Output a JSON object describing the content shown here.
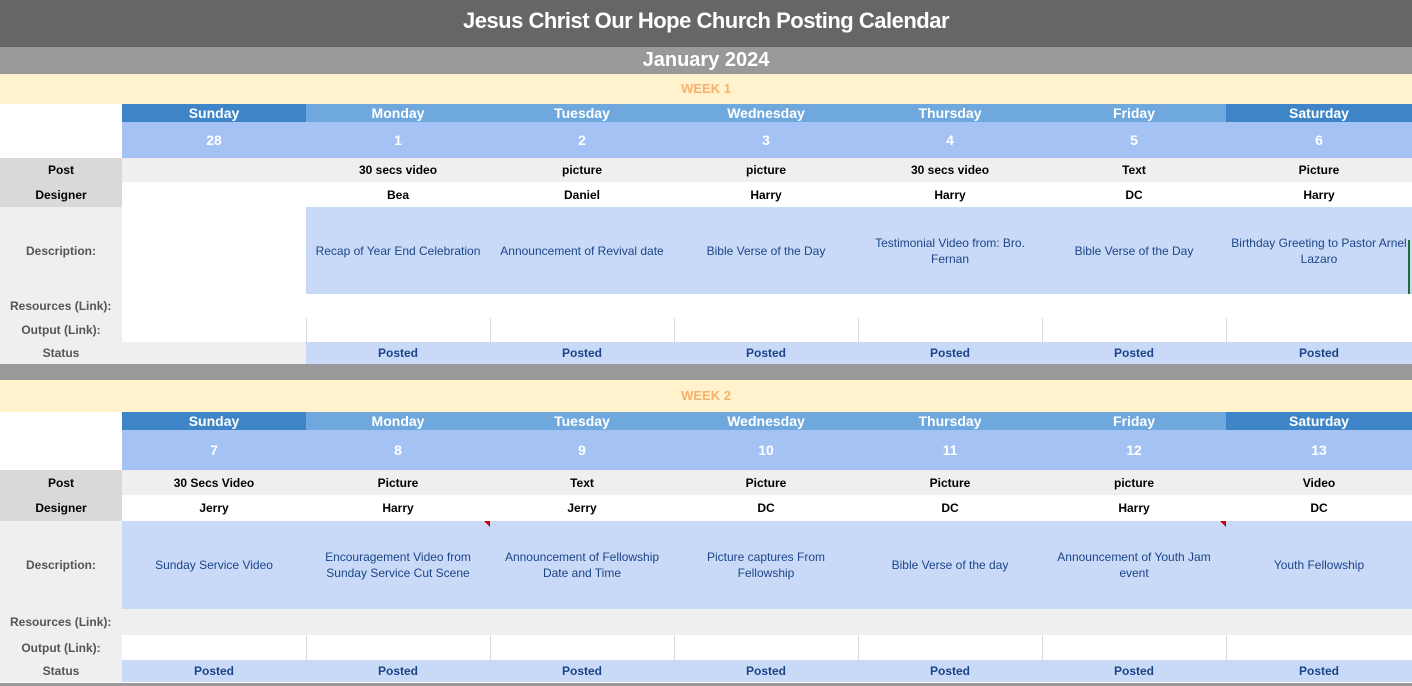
{
  "title": "Jesus Christ Our Hope Church Posting Calendar",
  "month": "January 2024",
  "row_labels": {
    "post": "Post",
    "designer": "Designer",
    "description": "Description:",
    "resources": "Resources (Link):",
    "output": "Output (Link):",
    "status": "Status"
  },
  "days": [
    "Sunday",
    "Monday",
    "Tuesday",
    "Wednesday",
    "Thursday",
    "Friday",
    "Saturday"
  ],
  "colors": {
    "title_bg": "#666666",
    "month_bg": "#999999",
    "week_bg": "#fff2cc",
    "week_text": "#f6b26b",
    "weekend_header": "#3d85c6",
    "weekday_header": "#6fa8dc",
    "date_row": "#a4c2f4",
    "description_bg": "#c9daf8",
    "status_text": "#1c4587"
  },
  "weeks": [
    {
      "label": "WEEK 1",
      "dates": [
        "28",
        "1",
        "2",
        "3",
        "4",
        "5",
        "6"
      ],
      "post": [
        "",
        "30 secs video",
        "picture",
        "picture",
        "30 secs video",
        "Text",
        "Picture"
      ],
      "designer": [
        "",
        "Bea",
        "Daniel",
        "Harry",
        "Harry",
        "DC",
        "Harry"
      ],
      "description": [
        "",
        "Recap of Year End Celebration",
        "Announcement of Revival date",
        "Bible Verse of the Day",
        "Testimonial Video from: Bro. Fernan",
        "Bible Verse of the Day",
        "Birthday Greeting to Pastor Arnel Lazaro"
      ],
      "status": [
        "",
        "Posted",
        "Posted",
        "Posted",
        "Posted",
        "Posted",
        "Posted"
      ]
    },
    {
      "label": "WEEK 2",
      "dates": [
        "7",
        "8",
        "9",
        "10",
        "11",
        "12",
        "13"
      ],
      "post": [
        "30 Secs Video",
        "Picture",
        "Text",
        "Picture",
        "Picture",
        "picture",
        "Video"
      ],
      "designer": [
        "Jerry",
        "Harry",
        "Jerry",
        "DC",
        "DC",
        "Harry",
        "DC"
      ],
      "description": [
        "Sunday Service Video",
        "Encouragement Video from Sunday Service Cut Scene",
        "Announcement of Fellowship Date and Time",
        "Picture captures From Fellowship",
        "Bible Verse of the day",
        "Announcement of Youth Jam event",
        "Youth Fellowship"
      ],
      "status": [
        "Posted",
        "Posted",
        "Posted",
        "Posted",
        "Posted",
        "Posted",
        "Posted"
      ]
    }
  ]
}
